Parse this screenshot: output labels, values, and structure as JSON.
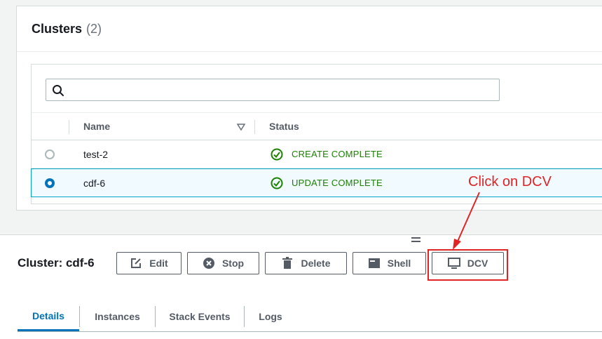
{
  "clusters_panel": {
    "title": "Clusters",
    "count": "(2)",
    "search": {
      "placeholder": "",
      "value": ""
    },
    "columns": {
      "name": "Name",
      "status": "Status"
    },
    "rows": [
      {
        "name": "test-2",
        "status": "CREATE COMPLETE",
        "selected": false
      },
      {
        "name": "cdf-6",
        "status": "UPDATE COMPLETE",
        "selected": true
      }
    ]
  },
  "detail": {
    "title": "Cluster: cdf-6",
    "buttons": {
      "edit": "Edit",
      "stop": "Stop",
      "delete": "Delete",
      "shell": "Shell",
      "dcv": "DCV"
    },
    "tabs": [
      "Details",
      "Instances",
      "Stack Events",
      "Logs"
    ],
    "active_tab": "Details"
  },
  "annotation": {
    "text": "Click on DCV"
  },
  "colors": {
    "accent": "#0073bb",
    "success": "#1d8102",
    "annotation": "#e02424"
  }
}
